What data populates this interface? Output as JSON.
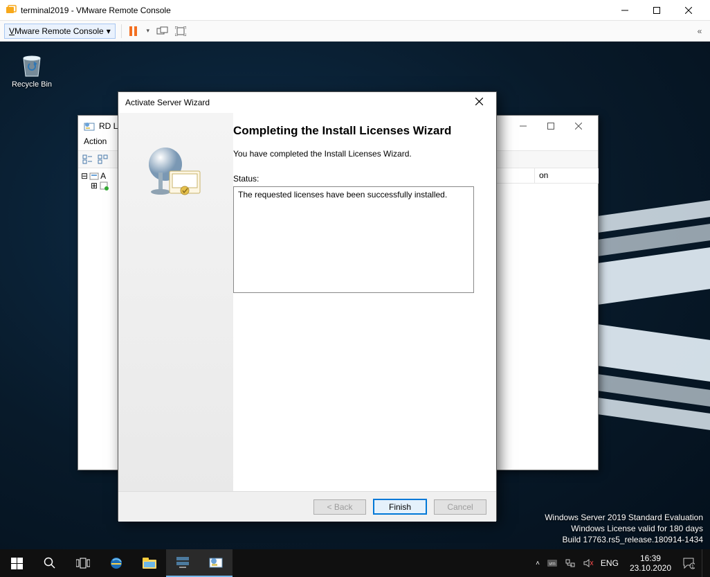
{
  "vmware": {
    "title": "terminal2019 - VMware Remote Console",
    "menu_label_pre": "V",
    "menu_label_rest": "Mware Remote Console"
  },
  "desktop": {
    "recycle_bin": "Recycle Bin"
  },
  "rd_window": {
    "title_visible": "RD L",
    "menu_action": "Action",
    "tree_root_visible": "A",
    "column_right_visible": "on"
  },
  "wizard": {
    "title": "Activate Server Wizard",
    "heading": "Completing the Install Licenses Wizard",
    "subtitle": "You have completed the Install Licenses Wizard.",
    "status_label": "Status:",
    "status_text": "The requested licenses have been successfully installed.",
    "btn_back": "< Back",
    "btn_finish": "Finish",
    "btn_cancel": "Cancel"
  },
  "watermark": {
    "line1": "Windows Server 2019 Standard Evaluation",
    "line2": "Windows License valid for 180 days",
    "line3": "Build 17763.rs5_release.180914-1434"
  },
  "tray": {
    "lang": "ENG",
    "time": "16:39",
    "date": "23.10.2020"
  }
}
